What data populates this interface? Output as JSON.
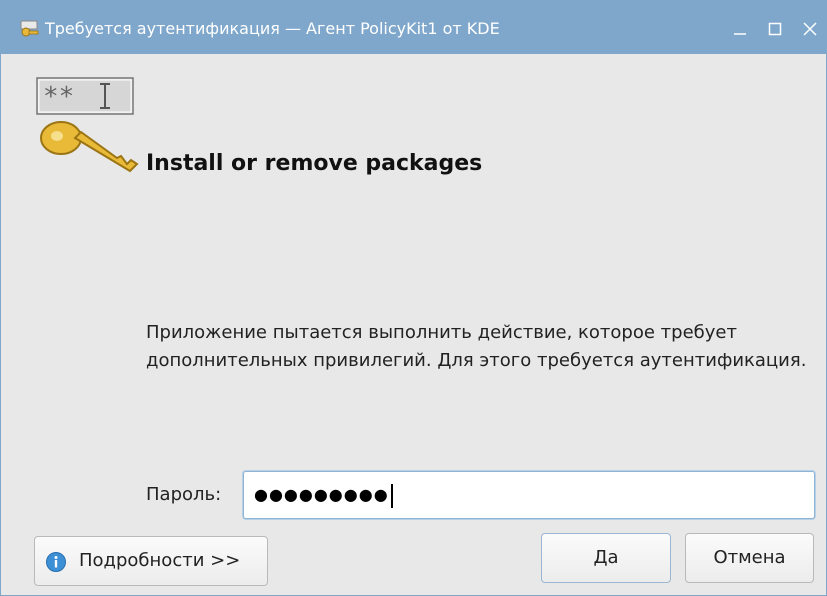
{
  "window": {
    "title": "Требуется аутентификация — Агент PolicyKit1 от KDE",
    "controls": {
      "minimize": "_",
      "maximize": "□",
      "close": "✕"
    }
  },
  "icons": {
    "app": "kde-auth-icon",
    "key": "password-key-icon",
    "info": "info-icon"
  },
  "dialog": {
    "heading": "Install or remove packages",
    "message": "Приложение пытается выполнить действие, которое требует дополнительных привилегий. Для этого требуется аутентификация.",
    "password_label": "Пароль:",
    "password_value": "●●●●●●●●●"
  },
  "buttons": {
    "details": "Подробности >>",
    "ok": "Да",
    "cancel": "Отмена"
  },
  "colors": {
    "titlebar": "#7fa7cc",
    "window_bg": "#e8e8e8",
    "focus": "#8fb4d6"
  }
}
